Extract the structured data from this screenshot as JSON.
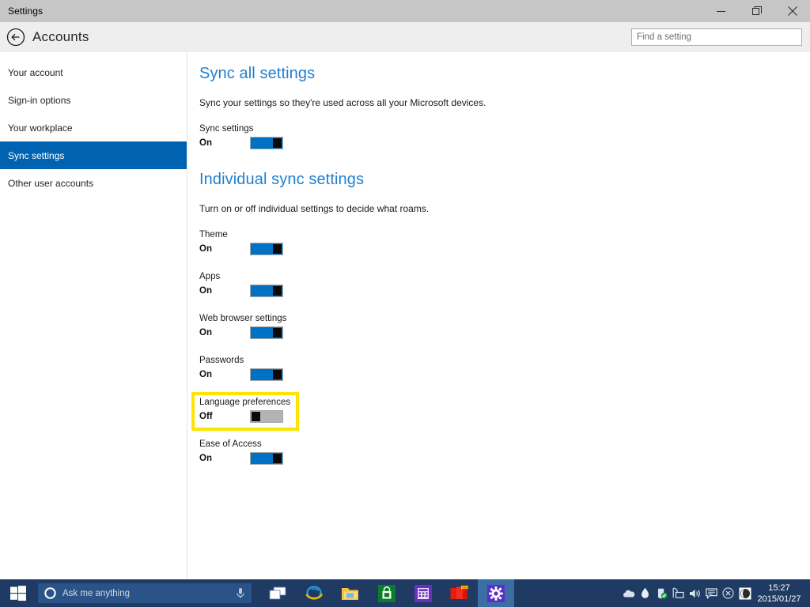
{
  "window": {
    "title": "Settings",
    "minimize_label": "Minimize",
    "maximize_label": "Restore",
    "close_label": "Close"
  },
  "header": {
    "back_label": "Back",
    "page_title": "Accounts",
    "search_placeholder": "Find a setting",
    "search_value": ""
  },
  "sidebar": {
    "items": [
      {
        "label": "Your account",
        "selected": false
      },
      {
        "label": "Sign-in options",
        "selected": false
      },
      {
        "label": "Your workplace",
        "selected": false
      },
      {
        "label": "Sync settings",
        "selected": true
      },
      {
        "label": "Other user accounts",
        "selected": false
      }
    ]
  },
  "main": {
    "section1": {
      "heading": "Sync all settings",
      "description": "Sync your settings so they're used across all your Microsoft devices.",
      "setting": {
        "label": "Sync settings",
        "state": "On"
      }
    },
    "section2": {
      "heading": "Individual sync settings",
      "description": "Turn on or off individual settings to decide what roams.",
      "settings": [
        {
          "label": "Theme",
          "state": "On"
        },
        {
          "label": "Apps",
          "state": "On"
        },
        {
          "label": "Web browser settings",
          "state": "On"
        },
        {
          "label": "Passwords",
          "state": "On"
        },
        {
          "label": "Language preferences",
          "state": "Off",
          "highlighted": true
        },
        {
          "label": "Ease of Access",
          "state": "On"
        }
      ]
    }
  },
  "taskbar": {
    "start_label": "Start",
    "cortana_placeholder": "Ask me anything",
    "cortana_value": "",
    "apps": [
      {
        "name": "task-view",
        "label": "Task View"
      },
      {
        "name": "internet-explorer",
        "label": "Internet Explorer"
      },
      {
        "name": "file-explorer",
        "label": "File Explorer"
      },
      {
        "name": "store",
        "label": "Store"
      },
      {
        "name": "calculator",
        "label": "Calculator"
      },
      {
        "name": "red-app",
        "label": "App"
      },
      {
        "name": "settings",
        "label": "Settings",
        "active": true
      }
    ],
    "tray": [
      {
        "name": "onedrive-icon",
        "label": "OneDrive"
      },
      {
        "name": "water-drop-icon",
        "label": "Droplet"
      },
      {
        "name": "security-shield-icon",
        "label": "Security"
      },
      {
        "name": "network-icon",
        "label": "Network"
      },
      {
        "name": "volume-icon",
        "label": "Volume"
      },
      {
        "name": "action-center-icon",
        "label": "Action Center"
      },
      {
        "name": "close-circle-icon",
        "label": "Dismiss"
      },
      {
        "name": "moon-circle-icon",
        "label": "App"
      }
    ],
    "clock": {
      "time": "15:27",
      "date": "2015/01/27"
    }
  },
  "colors": {
    "accent_blue": "#0063b1",
    "heading_blue": "#1f7fd0",
    "toggle_on": "#0072c6",
    "toggle_off": "#b3b3b3",
    "highlight_yellow": "#ffe400",
    "taskbar": "#1f3a63"
  }
}
